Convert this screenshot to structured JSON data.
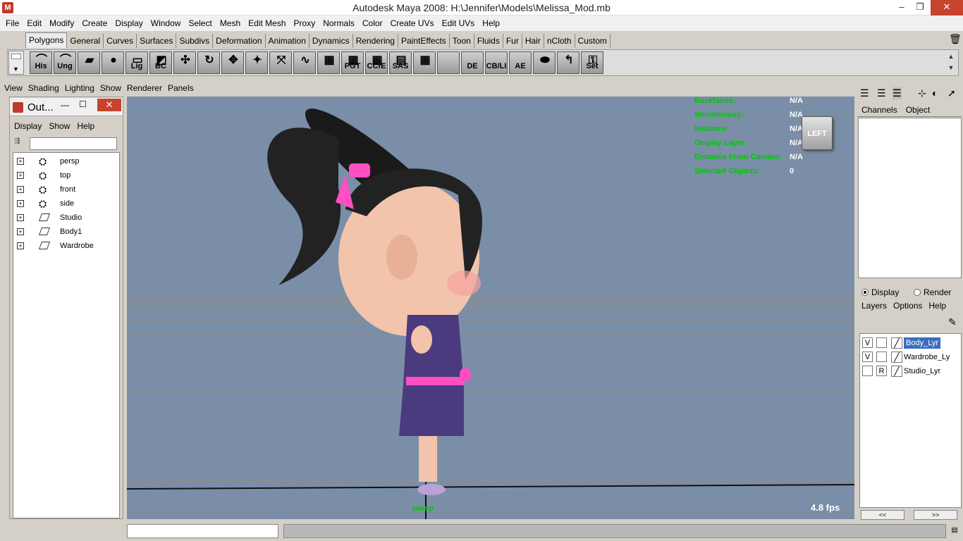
{
  "window": {
    "title": "Autodesk Maya 2008: H:\\Jennifer\\Models\\Melissa_Mod.mb",
    "minimize": "–",
    "maximize": "❐",
    "close": "✕"
  },
  "menubar": [
    "File",
    "Edit",
    "Modify",
    "Create",
    "Display",
    "Window",
    "Select",
    "Mesh",
    "Edit Mesh",
    "Proxy",
    "Normals",
    "Color",
    "Create UVs",
    "Edit UVs",
    "Help"
  ],
  "shelf_tabs": [
    "Polygons",
    "General",
    "Curves",
    "Surfaces",
    "Subdivs",
    "Deformation",
    "Animation",
    "Dynamics",
    "Rendering",
    "PaintEffects",
    "Toon",
    "Fluids",
    "Fur",
    "Hair",
    "nCloth",
    "Custom"
  ],
  "shelf_tools": [
    "His",
    "Ung",
    "",
    "",
    "Lig",
    "BC",
    "",
    "",
    "",
    "",
    "",
    "",
    "",
    "PGT",
    "CCfE",
    "SAS",
    "",
    "",
    "DE",
    "CB/LI",
    "AE",
    "",
    "",
    "Set"
  ],
  "panel_menu": [
    "View",
    "Shading",
    "Lighting",
    "Show",
    "Renderer",
    "Panels"
  ],
  "outliner": {
    "title": "Out...",
    "menu": [
      "Display",
      "Show",
      "Help"
    ],
    "items": [
      {
        "name": "persp",
        "type": "camera"
      },
      {
        "name": "top",
        "type": "camera"
      },
      {
        "name": "front",
        "type": "camera"
      },
      {
        "name": "side",
        "type": "camera"
      },
      {
        "name": "Studio",
        "type": "set"
      },
      {
        "name": "Body1",
        "type": "set"
      },
      {
        "name": "Wardrobe",
        "type": "set"
      }
    ]
  },
  "hud": {
    "labels": [
      "Backfaces:",
      "Smoothness:",
      "Instance:",
      "Display Layer:",
      "Distance From Camera:",
      "Selected Objects:"
    ],
    "values": [
      "N/A",
      "N/A",
      "N/A",
      "N/A",
      "N/A",
      "0"
    ]
  },
  "viewcube_label": "LEFT",
  "camera_label": "persp",
  "fps": "4.8 fps",
  "channel_box": {
    "tabs": [
      "Channels",
      "Object"
    ]
  },
  "layer_editor": {
    "modes": [
      "Display",
      "Render"
    ],
    "selected_mode": "Display",
    "menu": [
      "Layers",
      "Options",
      "Help"
    ],
    "layers": [
      {
        "visible": "V",
        "type": "",
        "name": "Body_Lyr",
        "selected": true
      },
      {
        "visible": "V",
        "type": "",
        "name": "Wardrobe_Ly",
        "selected": false
      },
      {
        "visible": "",
        "type": "R",
        "name": "Studio_Lyr",
        "selected": false
      }
    ],
    "nav_prev": "<<",
    "nav_next": ">>"
  },
  "colors": {
    "viewport_bg": "#7a8ea8",
    "hud_label": "#00c800",
    "selection": "#3a6ec0"
  }
}
